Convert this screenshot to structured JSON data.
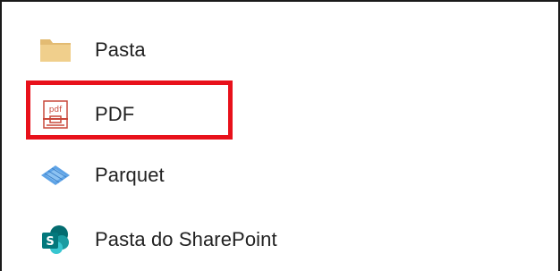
{
  "list": {
    "items": [
      {
        "label": "Pasta",
        "icon": "folder-icon"
      },
      {
        "label": "PDF",
        "icon": "pdf-icon"
      },
      {
        "label": "Parquet",
        "icon": "parquet-icon"
      },
      {
        "label": "Pasta do SharePoint",
        "icon": "sharepoint-icon"
      }
    ]
  },
  "colors": {
    "folder": "#e8c27a",
    "pdf": "#c9483b",
    "parquet": "#4a90d9",
    "sharepoint": "#0b7a75",
    "highlight": "#e8111b"
  }
}
